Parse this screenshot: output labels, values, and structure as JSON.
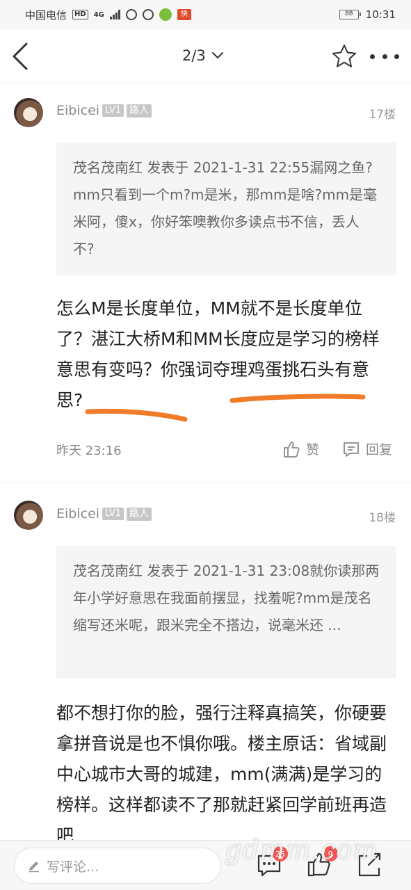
{
  "statusbar": {
    "carrier": "中国电信",
    "network_badge": "HD",
    "network_type": "4G",
    "battery": "88",
    "time": "10:31"
  },
  "nav": {
    "page_indicator": "2/3"
  },
  "posts": [
    {
      "author": "Eibicei",
      "level": "LV1",
      "role": "路人",
      "floor": "17楼",
      "quote": "茂名茂南红 发表于 2021-1-31 22:55漏网之鱼?mm只看到一个m?m是米，那mm是啥?mm是毫米阿，傻x，你好笨噢教你多读点书不信，丢人不?",
      "content": "怎么M是长度单位，MM就不是长度单位了？湛江大桥M和MM长度应是学习的榜样意思有变吗？你强词夺理鸡蛋挑石头有意思?",
      "time": "昨天 23:16",
      "like_label": "赞",
      "reply_label": "回复"
    },
    {
      "author": "Eibicei",
      "level": "LV1",
      "role": "路人",
      "floor": "18楼",
      "quote": "茂名茂南红 发表于 2021-1-31 23:08就你读那两年小学好意思在我面前摆显，找羞呢?mm是茂名缩写还米呢，跟米完全不搭边，说毫米还 ...",
      "content": "都不想打你的脸，强行注释真搞笑，你硬要拿拼音说是也不惧你哦。楼主原话：省域副中心城市大哥的城建，mm(满满)是学习的榜样。这样都读不了那就赶紧回学前班再造吧"
    }
  ],
  "bottombar": {
    "comment_placeholder": "写评论...",
    "comment_count": "25",
    "like_count": "9"
  },
  "watermark": "gdmm.com",
  "colors": {
    "underline": "#f07c2a",
    "badge": "#f35555"
  }
}
